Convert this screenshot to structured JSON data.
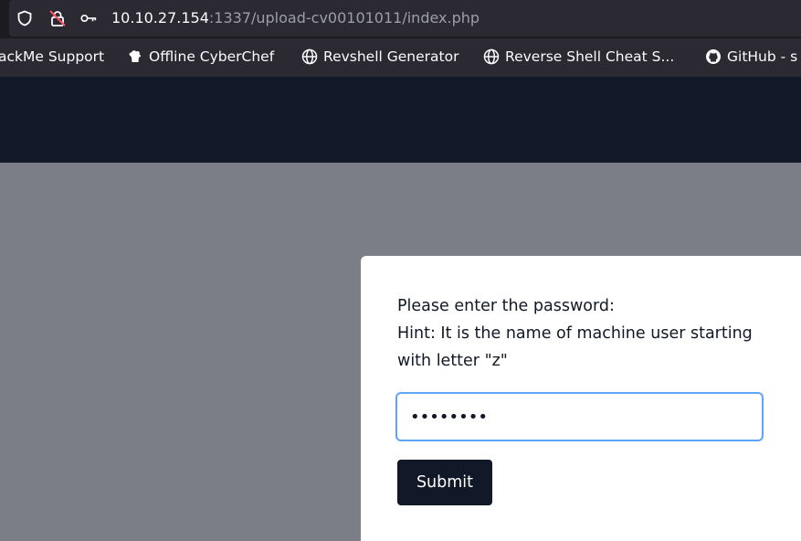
{
  "browser": {
    "url_host": "10.10.27.154",
    "url_rest": ":1337/upload-cv00101011/index.php",
    "icons": [
      "shield-icon",
      "insecure-lock-icon",
      "key-icon"
    ]
  },
  "bookmarks": [
    {
      "label": "ackMe Support",
      "icon": ""
    },
    {
      "label": "Offline CyberChef",
      "icon": "chef-icon"
    },
    {
      "label": "Revshell Generator",
      "icon": "globe-icon"
    },
    {
      "label": "Reverse Shell Cheat S...",
      "icon": "globe-icon"
    },
    {
      "label": "GitHub - s",
      "icon": "github-icon"
    }
  ],
  "form": {
    "prompt_line1": "Please enter the password:",
    "prompt_line2": "Hint: It is the name of machine user starting",
    "prompt_line3": "with letter \"z\"",
    "password_value": "zzzzzzzz",
    "submit_label": "Submit"
  },
  "colors": {
    "header_bg": "#111827",
    "page_bg": "#7b7e86",
    "input_focus": "#60a5fa",
    "button_bg": "#111827"
  }
}
